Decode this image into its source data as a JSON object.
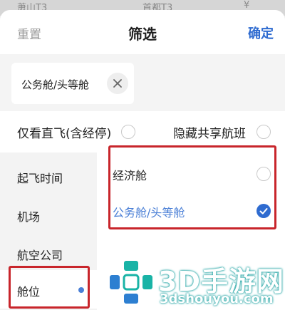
{
  "backdrop": {
    "items": [
      "萧山T3",
      "首都T3",
      "¥"
    ]
  },
  "header": {
    "reset": "重置",
    "title": "筛选",
    "confirm": "确定"
  },
  "summary": {
    "chip_label": "公务舱/头等舱"
  },
  "toggles": [
    {
      "label": "仅看直飞(含经停)",
      "checked": false
    },
    {
      "label": "隐藏共享航班",
      "checked": false
    }
  ],
  "categories": [
    {
      "label": "起飞时间",
      "active": false
    },
    {
      "label": "机场",
      "active": false
    },
    {
      "label": "航空公司",
      "active": false
    },
    {
      "label": "舱位",
      "active": true
    }
  ],
  "options": [
    {
      "label": "经济舱",
      "selected": false
    },
    {
      "label": "公务舱/头等舱",
      "selected": true
    }
  ],
  "colors": {
    "accent": "#2e6bd0",
    "selected_text": "#4a7fd6",
    "annotation_red": "#c8252b"
  },
  "watermark": {
    "text": "3D手游网",
    "url": "3dshouyou.com"
  }
}
